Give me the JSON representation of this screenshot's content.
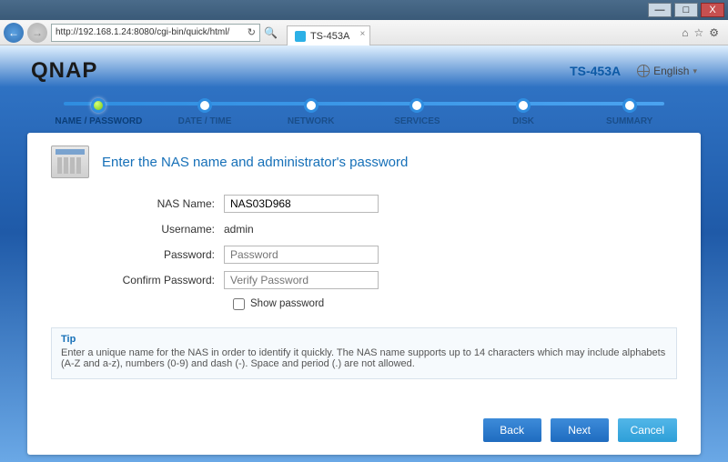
{
  "window": {
    "min": "—",
    "max": "□",
    "close": "X",
    "home_icon": "⌂",
    "star_icon": "☆",
    "gear_icon": "⚙"
  },
  "browser": {
    "url": "http://192.168.1.24:8080/cgi-bin/quick/html/",
    "tab_title": "TS-453A",
    "back": "←",
    "fwd": "→",
    "refresh": "↻",
    "search": "🔍",
    "tab_x": "×"
  },
  "header": {
    "brand": "QNAP",
    "model": "TS-453A",
    "language_label": "English",
    "caret": "▾"
  },
  "stepper": {
    "items": [
      {
        "label": "NAME / PASSWORD"
      },
      {
        "label": "DATE / TIME"
      },
      {
        "label": "NETWORK"
      },
      {
        "label": "SERVICES"
      },
      {
        "label": "DISK"
      },
      {
        "label": "SUMMARY"
      }
    ],
    "active_index": 0
  },
  "card": {
    "title": "Enter the NAS name and administrator's password"
  },
  "form": {
    "nas_name_label": "NAS Name:",
    "nas_name_value": "NAS03D968",
    "username_label": "Username:",
    "username_value": "admin",
    "password_label": "Password:",
    "password_placeholder": "Password",
    "confirm_label": "Confirm Password:",
    "confirm_placeholder": "Verify Password",
    "show_password_label": "Show password"
  },
  "tip": {
    "heading": "Tip",
    "body": "Enter a unique name for the NAS in order to identify it quickly. The NAS name supports up to 14 characters which may include alphabets (A-Z and a-z), numbers (0-9) and dash (-). Space and period (.) are not allowed."
  },
  "buttons": {
    "back": "Back",
    "next": "Next",
    "cancel": "Cancel"
  }
}
